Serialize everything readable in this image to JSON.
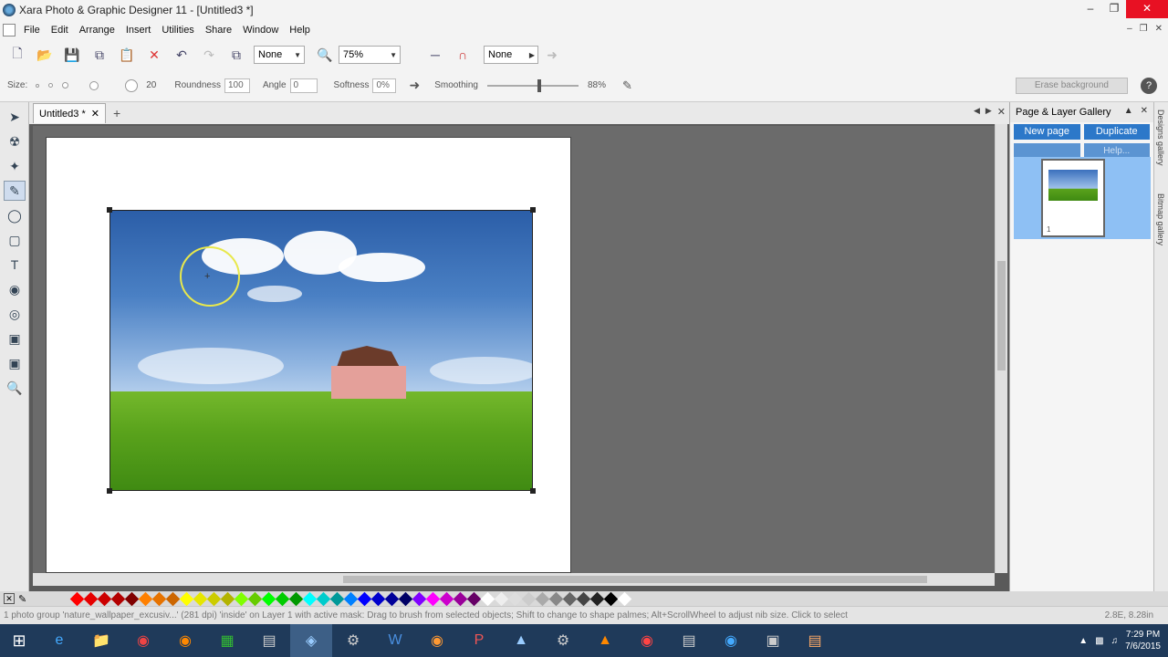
{
  "window": {
    "title": "Xara Photo & Graphic Designer 11 - [Untitled3 *]"
  },
  "menu": [
    "File",
    "Edit",
    "Arrange",
    "Insert",
    "Utilities",
    "Share",
    "Window",
    "Help"
  ],
  "toolbar": {
    "select1": "None",
    "zoom": "75%",
    "select2": "None"
  },
  "infobar": {
    "size_label": "Size:",
    "size_value": "20",
    "roundness_label": "Roundness",
    "roundness_value": "100",
    "angle_label": "Angle",
    "angle_value": "0",
    "softness_label": "Softness",
    "softness_value": "0%",
    "smoothing_label": "Smoothing",
    "smoothing_value": "88%",
    "erase_bg": "Erase background",
    "help": "?"
  },
  "doc_tab": {
    "label": "Untitled3 *"
  },
  "gallery": {
    "title": "Page & Layer Gallery",
    "new_page": "New page",
    "duplicate": "Duplicate",
    "help": "Help...",
    "page_num": "1"
  },
  "side_tabs": [
    "Designs gallery",
    "Bitmap gallery"
  ],
  "status": "1 photo group 'nature_wallpaper_excusiv...' (281 dpi) 'inside' on Layer 1 with active mask: Drag to brush from selected objects; Shift to change to shape palmes; Alt+ScrollWheel to adjust nib size. Click to select",
  "status_right": "2.8E, 8.28in",
  "clock": {
    "time": "7:29 PM",
    "date": "7/6/2015"
  },
  "colors": {
    "swatches": [
      "#ff0000",
      "#e60000",
      "#cc0000",
      "#b30000",
      "#800000",
      "#ff8000",
      "#e67300",
      "#cc6600",
      "#ffff00",
      "#e6e600",
      "#cccc00",
      "#b3b300",
      "#80ff00",
      "#66cc00",
      "#00ff00",
      "#00cc00",
      "#009900",
      "#00ffff",
      "#00cccc",
      "#009999",
      "#0080ff",
      "#0000ff",
      "#0000cc",
      "#000099",
      "#000066",
      "#8000ff",
      "#ff00ff",
      "#cc00cc",
      "#990099",
      "#660066",
      "#ffffff",
      "#eeeeee",
      "#dddddd",
      "#cccccc",
      "#aaaaaa",
      "#888888",
      "#666666",
      "#444444",
      "#222222",
      "#000000",
      "#ffffff"
    ]
  }
}
